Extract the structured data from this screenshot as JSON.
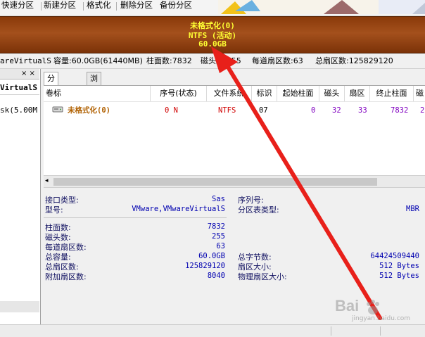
{
  "toolbar": {
    "items": [
      "快速分区",
      "新建分区",
      "格式化",
      "删除分区",
      "备份分区"
    ]
  },
  "disk_bar": {
    "line1": "未格式化(0)",
    "line2": "NTFS (活动)",
    "line3": "60.0GB"
  },
  "disk_info": {
    "model": "areVirtualS",
    "capacity": "容量:60.0GB(61440MB)",
    "cylinders": "柱面数:7832",
    "heads": "磁头数:255",
    "sectors_per_track": "每道扇区数:63",
    "total_sectors": "总扇区数:125829120"
  },
  "left_panel": {
    "header_controls": "× ×",
    "node1": "VirtualS",
    "node2": "sk(5.00M"
  },
  "tabs": [
    "分区参数",
    "浏览文件"
  ],
  "partition_table": {
    "headers": [
      "卷标",
      "序号(状态)",
      "文件系统",
      "标识",
      "起始柱面",
      "磁头",
      "扇区",
      "终止柱面",
      "磁"
    ],
    "row": {
      "label": "未格式化(0)",
      "index": "0 N",
      "fs": "NTFS",
      "id": "07",
      "start_cyl": "0",
      "head": "32",
      "sector": "33",
      "end_cyl": "7832",
      "extra": "2"
    }
  },
  "details": {
    "interface_type_label": "接口类型:",
    "interface_type_value": "Sas",
    "model_label": "型号:",
    "model_value": "VMware,VMwareVirtualS",
    "serial_label": "序列号:",
    "table_type_label": "分区表类型:",
    "table_type_value": "MBR",
    "cylinders_label": "柱面数:",
    "cylinders_value": "7832",
    "heads_label": "磁头数:",
    "heads_value": "255",
    "spt_label": "每道扇区数:",
    "spt_value": "63",
    "capacity_label": "总容量:",
    "capacity_value": "60.0GB",
    "total_bytes_label": "总字节数:",
    "total_bytes_value": "64424509440",
    "total_sectors_label": "总扇区数:",
    "total_sectors_value": "125829120",
    "sector_size_label": "扇区大小:",
    "sector_size_value": "512 Bytes",
    "extra_sectors_label": "附加扇区数:",
    "extra_sectors_value": "8040",
    "phys_sector_label": "物理扇区大小:",
    "phys_sector_value": "512 Bytes"
  },
  "watermark": {
    "brand": "Bai",
    "sub": "jingyan.baidu.com"
  },
  "colors": {
    "disk_bar": "#9a4814",
    "disk_text": "#ffff33",
    "arrow": "#e8201a",
    "row_label": "#b06000",
    "value_red": "#d00000",
    "value_purple": "#8000c0"
  }
}
